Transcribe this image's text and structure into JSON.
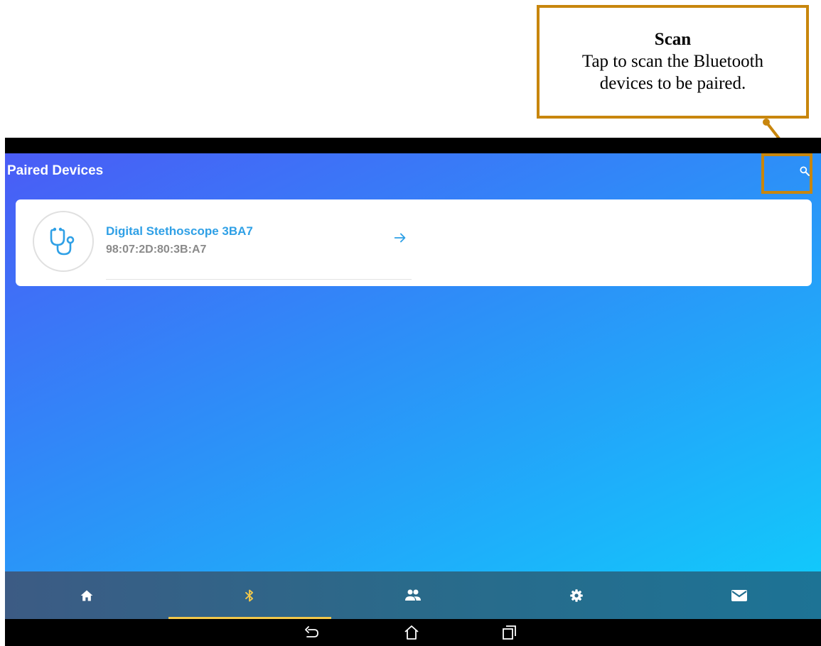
{
  "callout": {
    "title": "Scan",
    "body": "Tap to scan the Bluetooth devices to be paired."
  },
  "header": {
    "title": "Paired Devices",
    "scan_icon": "search-icon"
  },
  "devices": [
    {
      "name": "Digital Stethoscope 3BA7",
      "address": "98:07:2D:80:3B:A7",
      "icon": "stethoscope-icon"
    }
  ],
  "tabs": [
    {
      "icon": "home-icon",
      "active": false
    },
    {
      "icon": "bluetooth-icon",
      "active": true
    },
    {
      "icon": "people-icon",
      "active": false
    },
    {
      "icon": "settings-icon",
      "active": false
    },
    {
      "icon": "mail-icon",
      "active": false
    }
  ],
  "colors": {
    "accent": "#c8860d",
    "device_name": "#2fa0e6",
    "active_tab": "#f3c84a"
  }
}
